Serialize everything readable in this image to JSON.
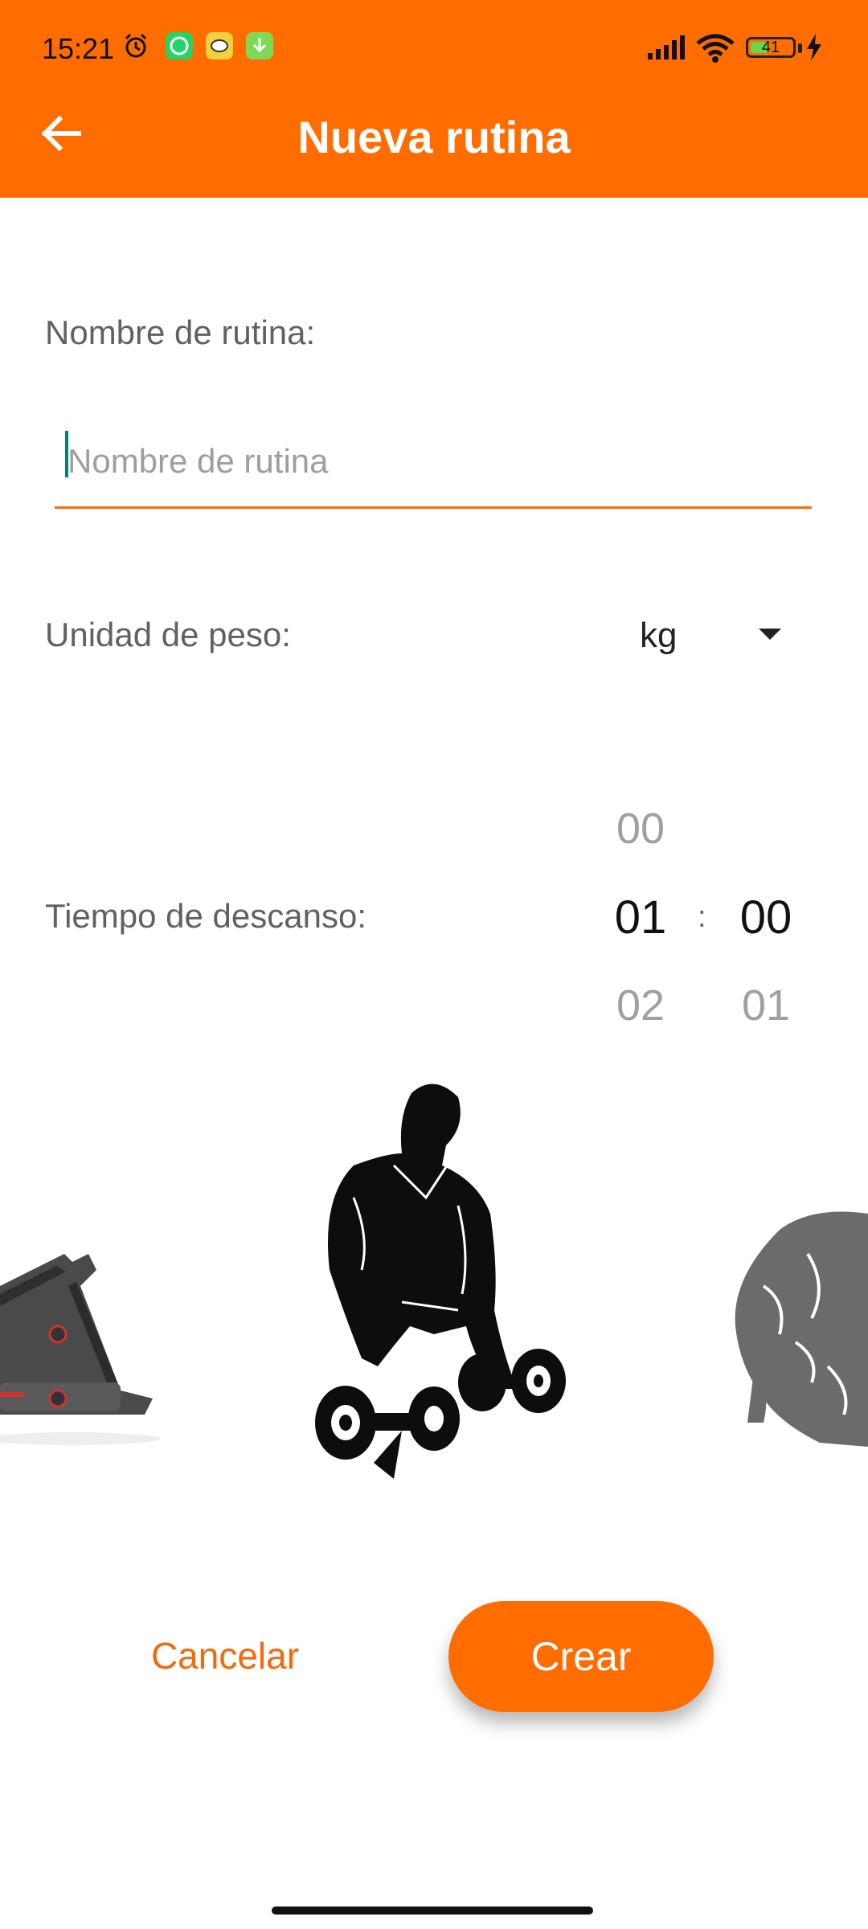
{
  "status_bar": {
    "time": "15:21",
    "battery_level": "41",
    "notification_icons": [
      "alarm-icon",
      "whatsapp-icon",
      "app-icon",
      "download-icon"
    ]
  },
  "app_bar": {
    "title": "Nueva rutina",
    "back_icon": "arrow-left-icon",
    "color": "#FF6D00"
  },
  "form": {
    "name_label": "Nombre de rutina:",
    "name_placeholder": "Nombre de rutina",
    "name_value": "",
    "unit_label": "Unidad de peso:",
    "unit_value": "kg",
    "rest_label": "Tiempo de descanso:",
    "rest_picker": {
      "minutes": {
        "prev": "00",
        "selected": "01",
        "next": "02"
      },
      "separator": ":",
      "seconds": {
        "prev": "",
        "selected": "00",
        "next": "01"
      }
    }
  },
  "carousel": {
    "items": [
      "treadmill-image",
      "dumbbell-curl-image",
      "muscle-torso-image"
    ]
  },
  "actions": {
    "cancel_label": "Cancelar",
    "create_label": "Crear",
    "accent": "#FF6D00"
  }
}
